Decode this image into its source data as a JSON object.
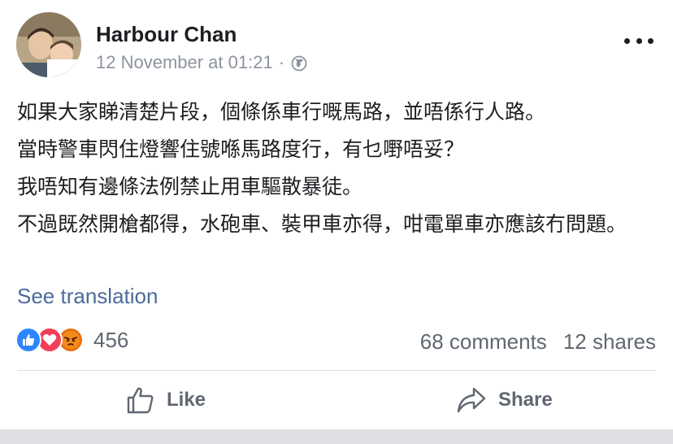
{
  "post": {
    "author": "Harbour Chan",
    "timestamp": "12 November at 01:21",
    "separator": "·",
    "privacy_icon": "globe-icon",
    "more_icon": "more-options-icon",
    "paragraphs": [
      "如果大家睇清楚片段，個條係車行嘅馬路，並唔係行人路。",
      "當時警車閃住燈響住號喺馬路度行，有乜嘢唔妥？",
      "我唔知有邊條法例禁止用車驅散暴徒。",
      "不過既然開槍都得，水砲車、裝甲車亦得，咁電單車亦應該冇問題。"
    ],
    "see_translation": "See translation"
  },
  "reactions": {
    "icons": [
      "like-reaction-icon",
      "love-reaction-icon",
      "angry-reaction-icon"
    ],
    "count": "456"
  },
  "stats": {
    "comments": "68 comments",
    "shares": "12 shares"
  },
  "actions": {
    "like_label": "Like",
    "share_label": "Share"
  },
  "colors": {
    "link": "#4b6b9b",
    "like_blue": "#2d86ff",
    "love_red": "#f33e58",
    "angry_orange": "#e9710f",
    "secondary_text": "#606770"
  }
}
